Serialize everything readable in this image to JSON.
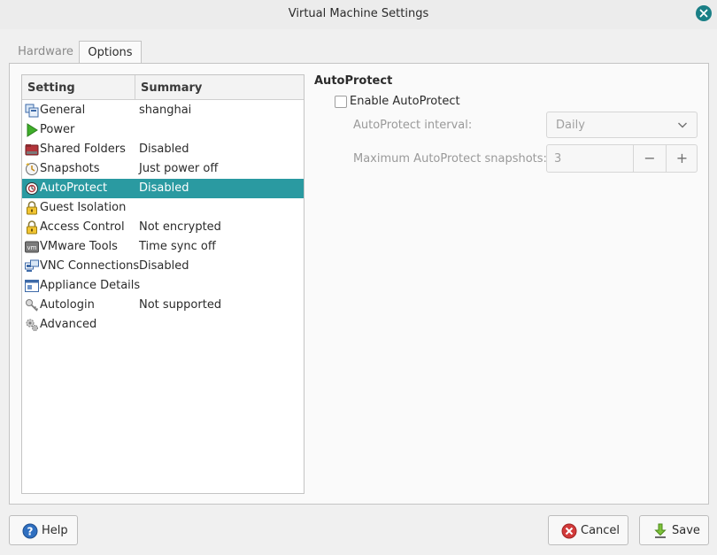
{
  "window": {
    "title": "Virtual Machine Settings"
  },
  "tabs": [
    {
      "label": "Hardware",
      "active": false
    },
    {
      "label": "Options",
      "active": true
    }
  ],
  "settings_list": {
    "headers": {
      "setting": "Setting",
      "summary": "Summary"
    },
    "rows": [
      {
        "icon": "general-icon",
        "name": "General",
        "summary": "shanghai"
      },
      {
        "icon": "power-icon",
        "name": "Power",
        "summary": ""
      },
      {
        "icon": "shared-folders-icon",
        "name": "Shared Folders",
        "summary": "Disabled"
      },
      {
        "icon": "snapshots-icon",
        "name": "Snapshots",
        "summary": "Just power off"
      },
      {
        "icon": "autoprotect-icon",
        "name": "AutoProtect",
        "summary": "Disabled",
        "selected": true
      },
      {
        "icon": "lock-icon",
        "name": "Guest Isolation",
        "summary": ""
      },
      {
        "icon": "lock-icon",
        "name": "Access Control",
        "summary": "Not encrypted"
      },
      {
        "icon": "vmware-tools-icon",
        "name": "VMware Tools",
        "summary": "Time sync off"
      },
      {
        "icon": "vnc-icon",
        "name": "VNC Connections",
        "summary": "Disabled"
      },
      {
        "icon": "appliance-icon",
        "name": "Appliance Details",
        "summary": ""
      },
      {
        "icon": "key-icon",
        "name": "Autologin",
        "summary": "Not supported"
      },
      {
        "icon": "gears-icon",
        "name": "Advanced",
        "summary": ""
      }
    ]
  },
  "autoprotect": {
    "section_title": "AutoProtect",
    "enable_label": "Enable AutoProtect",
    "enabled": false,
    "interval_label": "AutoProtect interval:",
    "interval_value": "Daily",
    "max_label": "Maximum AutoProtect snapshots:",
    "max_value": "3",
    "minus": "−",
    "plus": "+"
  },
  "buttons": {
    "help": "Help",
    "cancel": "Cancel",
    "save": "Save"
  },
  "colors": {
    "accent": "#2a9aa1",
    "close": "#1a7f86"
  }
}
